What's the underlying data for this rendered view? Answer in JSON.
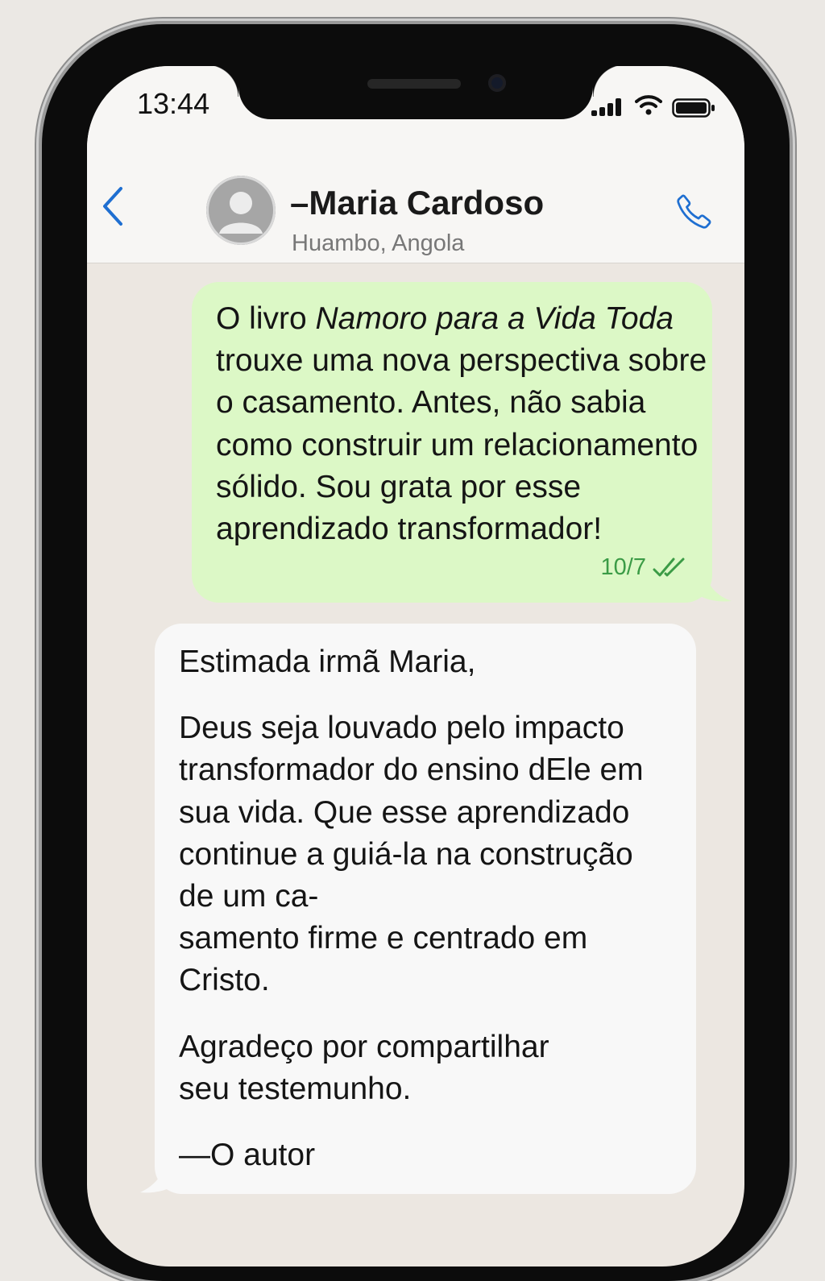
{
  "status_bar": {
    "time": "13:44",
    "signal_icon": "cellular-signal-icon",
    "wifi_icon": "wifi-icon",
    "battery_icon": "battery-icon"
  },
  "header": {
    "back_icon": "chevron-left-icon",
    "avatar_icon": "default-user-avatar-icon",
    "contact_name": "–Maria Cardoso",
    "contact_location": "Huambo, Angola",
    "call_icon": "phone-icon"
  },
  "messages": [
    {
      "direction": "outgoing",
      "text_before": "O livro ",
      "text_italic": "Namoro para a Vida Toda",
      "text_after": " trouxe uma nova perspectiva sobre o casamento. Antes, não sabia como construir um relacionamento sólido.  Sou grata por esse aprendizado transformador!",
      "date": "10/7",
      "status_icon": "double-check-read-icon"
    },
    {
      "direction": "incoming",
      "paragraphs": [
        "Estimada irmã Maria,",
        "Deus seja louvado pelo impacto transformador do ensino dEle em sua vida. Que esse aprendizado continue a guiá-la na construção de um ca-\nsamento firme e centrado em Cristo.",
        "Agradeço por compartilhar\nseu testemunho.",
        "—O autor"
      ]
    }
  ],
  "colors": {
    "accent_blue": "#1f6fd1",
    "outgoing_bubble": "#dcf8c6",
    "incoming_bubble": "#f8f8f8",
    "chat_background": "#ece7e1",
    "read_tick_green": "#3b9b46"
  }
}
